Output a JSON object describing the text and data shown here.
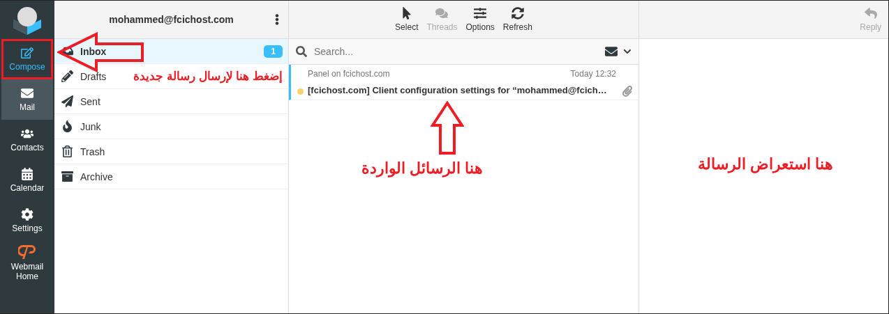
{
  "sidebar": {
    "items": [
      {
        "label": "Compose",
        "selected": false,
        "outlined": true
      },
      {
        "label": "Mail",
        "selected": true,
        "outlined": false
      },
      {
        "label": "Contacts",
        "selected": false,
        "outlined": false
      },
      {
        "label": "Calendar",
        "selected": false,
        "outlined": false
      },
      {
        "label": "Settings",
        "selected": false,
        "outlined": false
      },
      {
        "label": "Webmail Home",
        "selected": false,
        "outlined": false
      }
    ]
  },
  "folders": {
    "account": "mohammed@fcichost.com",
    "items": [
      {
        "name": "Inbox",
        "selected": true,
        "count": "1"
      },
      {
        "name": "Drafts",
        "selected": false
      },
      {
        "name": "Sent",
        "selected": false
      },
      {
        "name": "Junk",
        "selected": false
      },
      {
        "name": "Trash",
        "selected": false
      },
      {
        "name": "Archive",
        "selected": false
      }
    ]
  },
  "toolbar": [
    {
      "label": "Select",
      "disabled": false
    },
    {
      "label": "Threads",
      "disabled": true
    },
    {
      "label": "Options",
      "disabled": false
    },
    {
      "label": "Refresh",
      "disabled": false
    }
  ],
  "search": {
    "placeholder": "Search..."
  },
  "messages": [
    {
      "sender": "Panel on fcichost.com",
      "date": "Today 12:32",
      "subject": "[fcichost.com] Client configuration settings for “mohammed@fcich…",
      "unread": true,
      "attachment": true
    }
  ],
  "preview_toolbar": [
    {
      "label": "Reply",
      "disabled": true
    }
  ],
  "annotations": [
    {
      "kind": "arrow-left"
    },
    {
      "kind": "row-text",
      "text": "إضغط هنا لإرسال رسالة جديدة"
    },
    {
      "kind": "arrow-up"
    },
    {
      "kind": "text",
      "text": "هنا استعراض الرسالة"
    },
    {
      "kind": "text",
      "text": "هنا الرسائل الواردة"
    }
  ]
}
